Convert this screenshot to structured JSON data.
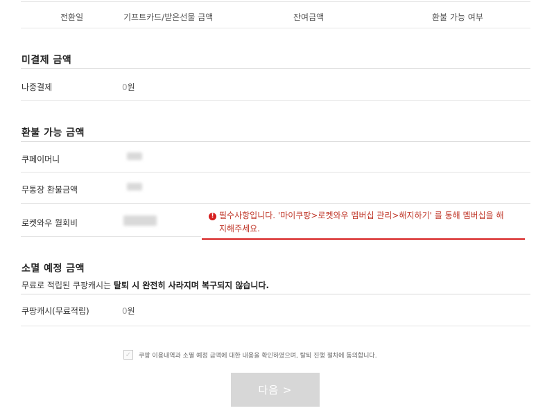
{
  "table_header": {
    "col1": "전환일",
    "col2": "기프트카드/받은선물 금액",
    "col3": "잔여금액",
    "col4": "환불 가능 여부"
  },
  "unpaid": {
    "title": "미결제 금액",
    "rows": [
      {
        "label": "나중결제",
        "amount": "0",
        "unit": "원"
      }
    ]
  },
  "refundable": {
    "title": "환불 가능 금액",
    "rows": [
      {
        "label": "쿠페이머니"
      },
      {
        "label": "무통장 환불금액"
      },
      {
        "label": "로켓와우 월회비"
      }
    ],
    "error": {
      "icon": "!",
      "line1": "필수사항입니다. '마이쿠팡>로켓와우 멤버십 관리>해지하기' 를 통해 멤버십을 해",
      "line2": "지해주세요."
    }
  },
  "expiring": {
    "title": "소멸 예정 금액",
    "subtitle_normal": "무료로 적립된 쿠팡캐시는 ",
    "subtitle_bold": "탈퇴 시 완전히 사라지며 복구되지 않습니다.",
    "rows": [
      {
        "label": "쿠팡캐시(무료적립)",
        "amount": "0",
        "unit": "원"
      }
    ]
  },
  "agreement": {
    "text": "쿠팡 이용내역과 소멸 예정 금액에 대한 내용을 확인하였으며, 탈퇴 진행 절차에 동의합니다.",
    "checked": false
  },
  "next_button": {
    "label": "다음 >"
  },
  "colors": {
    "error": "#d61f1f",
    "button_disabled": "#d7d7d7"
  }
}
